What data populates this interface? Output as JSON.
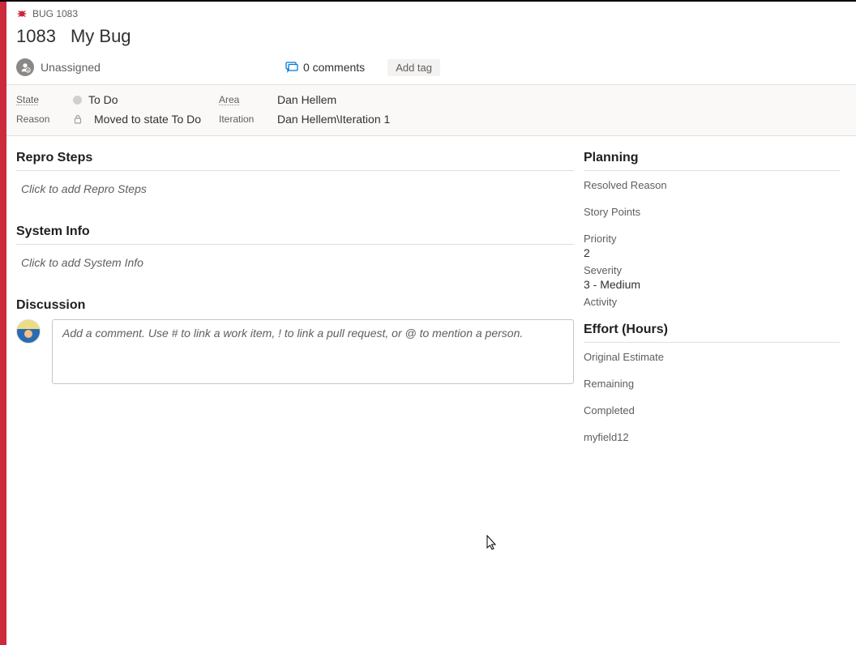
{
  "header": {
    "type_label": "BUG 1083",
    "id": "1083",
    "title": "My Bug",
    "assignee": "Unassigned",
    "comments_label": "0 comments",
    "add_tag_label": "Add tag"
  },
  "fields": {
    "state_label": "State",
    "state_value": "To Do",
    "area_label": "Area",
    "area_value": "Dan Hellem",
    "reason_label": "Reason",
    "reason_value": "Moved to state To Do",
    "iteration_label": "Iteration",
    "iteration_value": "Dan Hellem\\Iteration 1"
  },
  "sections": {
    "repro_heading": "Repro Steps",
    "repro_placeholder": "Click to add Repro Steps",
    "sysinfo_heading": "System Info",
    "sysinfo_placeholder": "Click to add System Info",
    "discussion_heading": "Discussion",
    "discussion_placeholder": "Add a comment. Use # to link a work item, ! to link a pull request, or @ to mention a person."
  },
  "planning": {
    "heading": "Planning",
    "resolved_reason_label": "Resolved Reason",
    "resolved_reason_value": "",
    "story_points_label": "Story Points",
    "story_points_value": "",
    "priority_label": "Priority",
    "priority_value": "2",
    "severity_label": "Severity",
    "severity_value": "3 - Medium",
    "activity_label": "Activity",
    "activity_value": ""
  },
  "effort": {
    "heading": "Effort (Hours)",
    "original_label": "Original Estimate",
    "original_value": "",
    "remaining_label": "Remaining",
    "remaining_value": "",
    "completed_label": "Completed",
    "completed_value": "",
    "custom_label": "myfield12",
    "custom_value": ""
  }
}
